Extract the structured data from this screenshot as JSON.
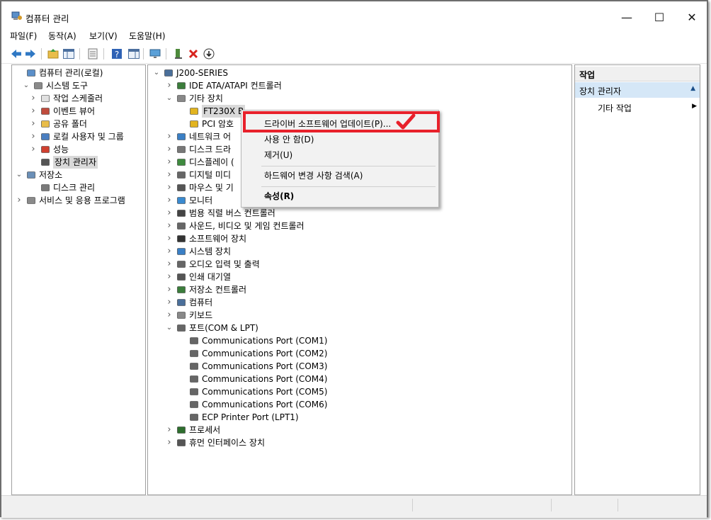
{
  "window": {
    "title": "컴퓨터 관리",
    "controls": {
      "minimize": "—",
      "maximize": "☐",
      "close": "✕"
    }
  },
  "menu": [
    {
      "label": "파일(F)"
    },
    {
      "label": "동작(A)"
    },
    {
      "label": "보기(V)"
    },
    {
      "label": "도움말(H)"
    }
  ],
  "toolbar": {
    "icons": [
      "back-arrow-icon",
      "forward-arrow-icon",
      "folder-up-icon",
      "show-hide-tree-icon",
      "properties-icon",
      "help-icon",
      "show-hide-action-icon",
      "monitor-icon",
      "scan-hardware-icon",
      "uninstall-x-icon",
      "update-driver-icon"
    ]
  },
  "left_tree": [
    {
      "label": "컴퓨터 관리(로컬)",
      "level": 0,
      "expander": "",
      "icon": "computer-management-icon"
    },
    {
      "label": "시스템 도구",
      "level": 1,
      "expander": "v",
      "icon": "tools-icon"
    },
    {
      "label": "작업 스케줄러",
      "level": 2,
      "expander": ">",
      "icon": "clock-icon"
    },
    {
      "label": "이벤트 뷰어",
      "level": 2,
      "expander": ">",
      "icon": "event-viewer-icon"
    },
    {
      "label": "공유 폴더",
      "level": 2,
      "expander": ">",
      "icon": "shared-folder-icon"
    },
    {
      "label": "로컬 사용자 및 그룹",
      "level": 2,
      "expander": ">",
      "icon": "users-icon"
    },
    {
      "label": "성능",
      "level": 2,
      "expander": ">",
      "icon": "performance-icon"
    },
    {
      "label": "장치 관리자",
      "level": 2,
      "expander": "",
      "icon": "device-manager-icon",
      "selected": true
    },
    {
      "label": "저장소",
      "level": 0,
      "expander": "v",
      "icon": "storage-icon"
    },
    {
      "label": "디스크 관리",
      "level": 2,
      "expander": "",
      "icon": "disk-icon"
    },
    {
      "label": "서비스 및 응용 프로그램",
      "level": 0,
      "expander": ">",
      "icon": "services-icon"
    }
  ],
  "device_tree": [
    {
      "label": "J200-SERIES",
      "level": 0,
      "expander": "v",
      "icon": "computer-icon"
    },
    {
      "label": "IDE ATA/ATAPI 컨트롤러",
      "level": 1,
      "expander": ">",
      "icon": "ide-controller-icon"
    },
    {
      "label": "기타 장치",
      "level": 1,
      "expander": "v",
      "icon": "unknown-device-icon"
    },
    {
      "label": "FT230X B",
      "level": 2,
      "expander": "",
      "icon": "warning-device-icon",
      "selected": true
    },
    {
      "label": "PCI 암호",
      "level": 2,
      "expander": "",
      "icon": "warning-device-icon"
    },
    {
      "label": "네트워크 어",
      "level": 1,
      "expander": ">",
      "icon": "network-icon"
    },
    {
      "label": "디스크 드라",
      "level": 1,
      "expander": ">",
      "icon": "disk-drive-icon"
    },
    {
      "label": "디스플레이 (",
      "level": 1,
      "expander": ">",
      "icon": "display-adapter-icon"
    },
    {
      "label": "디지털 미디",
      "level": 1,
      "expander": ">",
      "icon": "digital-media-icon"
    },
    {
      "label": "마우스 및 기",
      "level": 1,
      "expander": ">",
      "icon": "mouse-icon"
    },
    {
      "label": "모니터",
      "level": 1,
      "expander": ">",
      "icon": "monitor-icon"
    },
    {
      "label": "범용 직렬 버스 컨트롤러",
      "level": 1,
      "expander": ">",
      "icon": "usb-icon"
    },
    {
      "label": "사운드, 비디오 및 게임 컨트롤러",
      "level": 1,
      "expander": ">",
      "icon": "sound-icon"
    },
    {
      "label": "소프트웨어 장치",
      "level": 1,
      "expander": ">",
      "icon": "software-device-icon"
    },
    {
      "label": "시스템 장치",
      "level": 1,
      "expander": ">",
      "icon": "system-device-icon"
    },
    {
      "label": "오디오 입력 및 출력",
      "level": 1,
      "expander": ">",
      "icon": "audio-io-icon"
    },
    {
      "label": "인쇄 대기열",
      "level": 1,
      "expander": ">",
      "icon": "printer-icon"
    },
    {
      "label": "저장소 컨트롤러",
      "level": 1,
      "expander": ">",
      "icon": "storage-controller-icon"
    },
    {
      "label": "컴퓨터",
      "level": 1,
      "expander": ">",
      "icon": "computer-icon"
    },
    {
      "label": "키보드",
      "level": 1,
      "expander": ">",
      "icon": "keyboard-icon"
    },
    {
      "label": "포트(COM & LPT)",
      "level": 1,
      "expander": "v",
      "icon": "port-icon"
    },
    {
      "label": "Communications Port (COM1)",
      "level": 2,
      "expander": "",
      "icon": "port-icon"
    },
    {
      "label": "Communications Port (COM2)",
      "level": 2,
      "expander": "",
      "icon": "port-icon"
    },
    {
      "label": "Communications Port (COM3)",
      "level": 2,
      "expander": "",
      "icon": "port-icon"
    },
    {
      "label": "Communications Port (COM4)",
      "level": 2,
      "expander": "",
      "icon": "port-icon"
    },
    {
      "label": "Communications Port (COM5)",
      "level": 2,
      "expander": "",
      "icon": "port-icon"
    },
    {
      "label": "Communications Port (COM6)",
      "level": 2,
      "expander": "",
      "icon": "port-icon"
    },
    {
      "label": "ECP Printer Port (LPT1)",
      "level": 2,
      "expander": "",
      "icon": "port-icon"
    },
    {
      "label": "프로세서",
      "level": 1,
      "expander": ">",
      "icon": "processor-icon"
    },
    {
      "label": "휴먼 인터페이스 장치",
      "level": 1,
      "expander": ">",
      "icon": "hid-icon"
    }
  ],
  "context_menu": {
    "items": [
      {
        "label": "드라이버 소프트웨어 업데이트(P)...",
        "bold": false
      },
      {
        "label": "사용 안 함(D)",
        "bold": false
      },
      {
        "label": "제거(U)",
        "bold": false
      },
      {
        "label": "하드웨어 변경 사항 검색(A)",
        "bold": false
      },
      {
        "label": "속성(R)",
        "bold": true
      }
    ],
    "highlight_color": "#e8212b"
  },
  "actions": {
    "header": "작업",
    "section": "장치 관리자",
    "items": [
      {
        "label": "기타 작업"
      }
    ]
  }
}
